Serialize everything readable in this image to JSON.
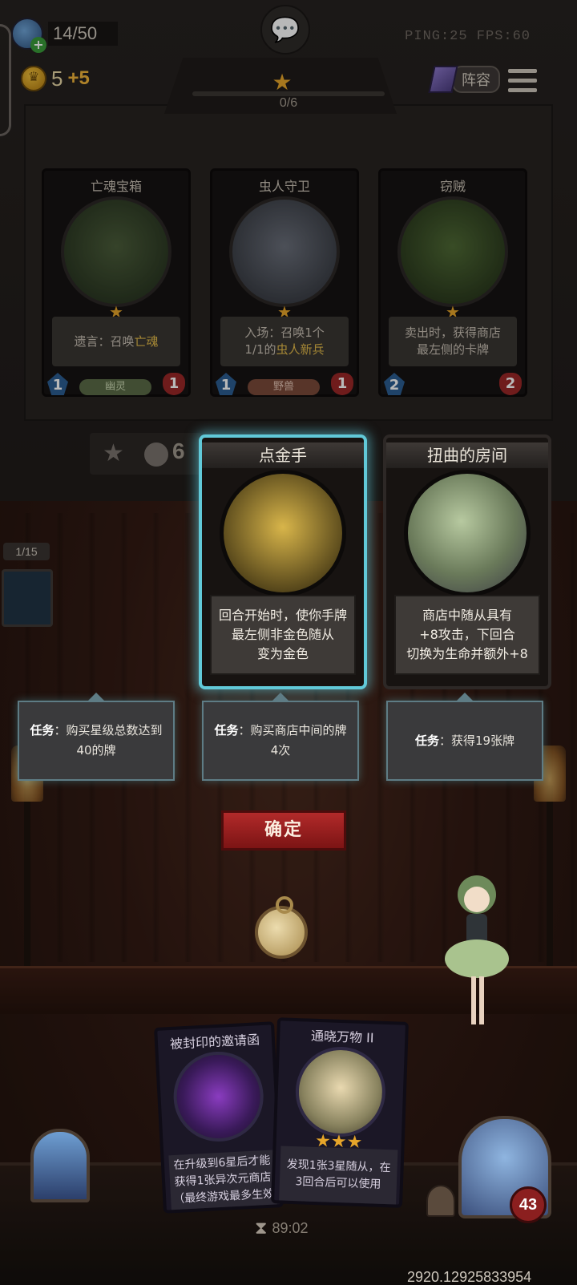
{
  "header": {
    "capacity": "14/50",
    "gold": "5",
    "gold_income": "+5",
    "ping_fps": "PING:25   FPS:60",
    "lineup_label": "阵容"
  },
  "tavern": {
    "tier_progress": "0/6",
    "tier_fill": 0.0,
    "upgrade_cost": "6"
  },
  "shop_minions": [
    {
      "name": "亡魂宝箱",
      "text_pre": "遗言：召唤",
      "text_hl": "亡魂",
      "text_line2": "",
      "tribe": "幽灵",
      "attack": "1",
      "health": "1"
    },
    {
      "name": "虫人守卫",
      "text_pre": "入场：召唤1个",
      "text_hl": "虫人新兵",
      "text_line2_pre": "1/1的",
      "tribe": "野兽",
      "attack": "1",
      "health": "1"
    },
    {
      "name": "窃贼",
      "text_line1": "卖出时，获得商店",
      "text_line2": "最左侧的卡牌",
      "attack": "2",
      "health": "2"
    }
  ],
  "side": {
    "counter": "1/15"
  },
  "quest_cards": [
    {
      "name": "点金手",
      "lines": [
        "回合开始时，使你手牌",
        "最左侧非金色随从",
        "变为金色"
      ],
      "task_label": "任务",
      "task_text": "：购买星级总数达到40的牌"
    },
    {
      "name": "扭曲的房间",
      "lines": [
        "商店中随从具有",
        "+8攻击，下回合",
        "切换为生命并额外+8"
      ],
      "task_label": "任务",
      "task_text": "：购买商店中间的牌4次"
    },
    {
      "task_label": "任务",
      "task_text": "：获得19张牌"
    }
  ],
  "confirm_label": "确定",
  "hand": [
    {
      "name": "被封印的邀请函",
      "lines": [
        "在升级到6星后才能",
        "获得1张异次元商店",
        "（最终游戏最多生效"
      ]
    },
    {
      "name": "通晓万物 II",
      "lines": [
        "发现1张3星随从，在",
        "3回合后可以使用"
      ],
      "stars": "★★★"
    }
  ],
  "footer": {
    "timer": "89:02",
    "player_health": "43",
    "build_id": "2920.12925833954"
  },
  "colors": {
    "accent_gold": "#e6a52a",
    "select_glow": "#61c9d8",
    "confirm_red": "#b22a2a"
  }
}
